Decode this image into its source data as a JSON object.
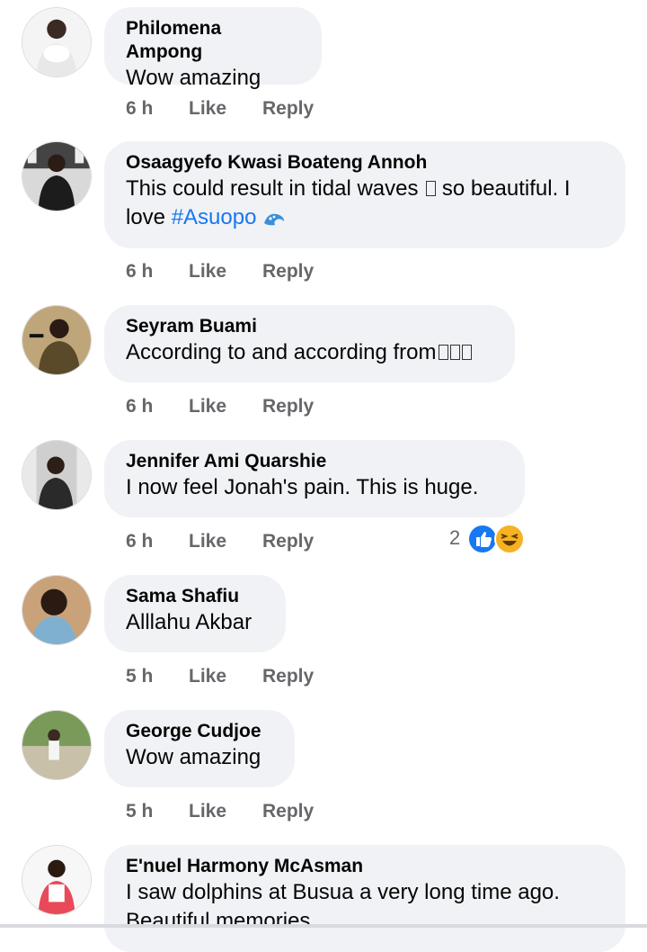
{
  "comments": [
    {
      "name": "Philomena Ampong",
      "text": "Wow amazing",
      "time": "6 h",
      "like": "Like",
      "reply": "Reply"
    },
    {
      "name": "Osaagyefo Kwasi Boateng Annoh",
      "text_line1": "This could result in tidal waves",
      "text_line1b": "so beautiful. I",
      "text_line2": "love",
      "hashtag": "#Asuopo",
      "time": "6 h",
      "like": "Like",
      "reply": "Reply"
    },
    {
      "name": "Seyram Buami",
      "text": "According to and according from",
      "time": "6 h",
      "like": "Like",
      "reply": "Reply"
    },
    {
      "name": "Jennifer Ami Quarshie",
      "text": "I now feel Jonah's pain.  This is huge.",
      "time": "6 h",
      "like": "Like",
      "reply": "Reply",
      "reaction_count": "2",
      "reaction_icons": [
        "like-icon",
        "laugh-icon"
      ]
    },
    {
      "name": "Sama Shafiu",
      "text": "Alllahu Akbar",
      "time": "5 h",
      "like": "Like",
      "reply": "Reply"
    },
    {
      "name": "George Cudjoe",
      "text": "Wow amazing",
      "time": "5 h",
      "like": "Like",
      "reply": "Reply"
    },
    {
      "name": "E'nuel Harmony McAsman",
      "text_line1": "I saw dolphins at Busua a very long time ago.",
      "text_line2": "Beautiful memories"
    }
  ],
  "colors": {
    "bubble": "#f0f2f5",
    "meta": "#65676b",
    "link": "#1877f2"
  }
}
